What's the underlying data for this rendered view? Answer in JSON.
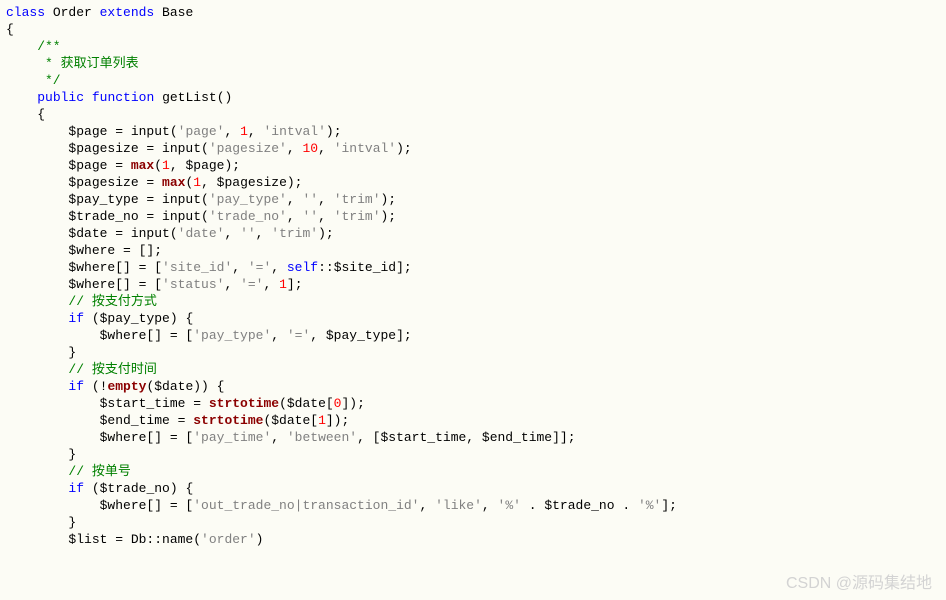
{
  "code": {
    "l1_class": "class",
    "l1_name": " Order ",
    "l1_extends": "extends",
    "l1_base": " Base",
    "l2": "{",
    "l3": "    /**",
    "l4": "     * 获取订单列表",
    "l5": "     */",
    "l6a": "    ",
    "l6_public": "public",
    "l6_sp": " ",
    "l6_function": "function",
    "l6_name": " getList",
    "l6_paren": "()",
    "l7": "    {",
    "l8a": "        $page = input(",
    "l8s1": "'page'",
    "l8b": ", ",
    "l8n1": "1",
    "l8c": ", ",
    "l8s2": "'intval'",
    "l8d": ");",
    "l9a": "        $pagesize = input(",
    "l9s1": "'pagesize'",
    "l9b": ", ",
    "l9n1": "10",
    "l9c": ", ",
    "l9s2": "'intval'",
    "l9d": ");",
    "l10a": "        $page = ",
    "l10_max": "max",
    "l10b": "(",
    "l10n": "1",
    "l10c": ", $page);",
    "l11a": "        $pagesize = ",
    "l11_max": "max",
    "l11b": "(",
    "l11n": "1",
    "l11c": ", $pagesize);",
    "l12a": "        $pay_type = input(",
    "l12s1": "'pay_type'",
    "l12b": ", ",
    "l12s2": "''",
    "l12c": ", ",
    "l12s3": "'trim'",
    "l12d": ");",
    "l13a": "        $trade_no = input(",
    "l13s1": "'trade_no'",
    "l13b": ", ",
    "l13s2": "''",
    "l13c": ", ",
    "l13s3": "'trim'",
    "l13d": ");",
    "l14a": "        $date = input(",
    "l14s1": "'date'",
    "l14b": ", ",
    "l14s2": "''",
    "l14c": ", ",
    "l14s3": "'trim'",
    "l14d": ");",
    "l15": "",
    "l16": "        $where = [];",
    "l17a": "        $where[] = [",
    "l17s1": "'site_id'",
    "l17b": ", ",
    "l17s2": "'='",
    "l17c": ", ",
    "l17_self": "self",
    "l17d": "::$site_id];",
    "l18a": "        $where[] = [",
    "l18s1": "'status'",
    "l18b": ", ",
    "l18s2": "'='",
    "l18c": ", ",
    "l18n": "1",
    "l18d": "];",
    "l19": "",
    "l20": "        // 按支付方式",
    "l21a": "        ",
    "l21_if": "if",
    "l21b": " ($pay_type) {",
    "l22a": "            $where[] = [",
    "l22s1": "'pay_type'",
    "l22b": ", ",
    "l22s2": "'='",
    "l22c": ", $pay_type];",
    "l23": "        }",
    "l24": "        // 按支付时间",
    "l25a": "        ",
    "l25_if": "if",
    "l25b": " (!",
    "l25_empty": "empty",
    "l25c": "($date)) {",
    "l26a": "            $start_time = ",
    "l26_fn": "strtotime",
    "l26b": "($date[",
    "l26n": "0",
    "l26c": "]);",
    "l27a": "            $end_time = ",
    "l27_fn": "strtotime",
    "l27b": "($date[",
    "l27n": "1",
    "l27c": "]);",
    "l28a": "            $where[] = [",
    "l28s1": "'pay_time'",
    "l28b": ", ",
    "l28s2": "'between'",
    "l28c": ", [$start_time, $end_time]];",
    "l29": "        }",
    "l30": "        // 按单号",
    "l31a": "        ",
    "l31_if": "if",
    "l31b": " ($trade_no) {",
    "l32a": "            $where[] = [",
    "l32s1": "'out_trade_no|transaction_id'",
    "l32b": ", ",
    "l32s2": "'like'",
    "l32c": ", ",
    "l32s3": "'%'",
    "l32d": " . $trade_no . ",
    "l32s4": "'%'",
    "l32e": "];",
    "l33": "        }",
    "l34": "",
    "l35a": "        $list = Db::name(",
    "l35s1": "'order'",
    "l35b": ")"
  },
  "watermark": "CSDN @源码集结地"
}
